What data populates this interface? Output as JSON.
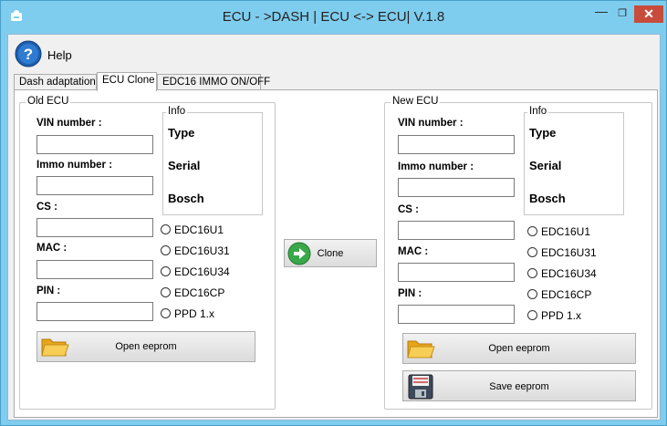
{
  "window": {
    "title": "ECU - >DASH | ECU <-> ECU|           V.1.8",
    "minimize": "—",
    "maximize": "❐",
    "close": "✕"
  },
  "help": {
    "label": "Help"
  },
  "tabs": [
    {
      "label": "Dash adaptation"
    },
    {
      "label": "ECU Clone"
    },
    {
      "label": "EDC16 IMMO ON/OFF"
    }
  ],
  "active_tab": "ECU Clone",
  "old_ecu": {
    "title": "Old ECU",
    "fields": {
      "vin": {
        "label": "VIN number :",
        "value": ""
      },
      "immo": {
        "label": "Immo number :",
        "value": ""
      },
      "cs": {
        "label": "CS :",
        "value": ""
      },
      "mac": {
        "label": "MAC :",
        "value": ""
      },
      "pin": {
        "label": "PIN :",
        "value": ""
      }
    },
    "info": {
      "title": "Info",
      "type": "Type",
      "serial": "Serial",
      "bosch": "Bosch"
    },
    "radios": [
      "EDC16U1",
      "EDC16U31",
      "EDC16U34",
      "EDC16CP",
      "PPD 1.x"
    ],
    "open_button": "Open eeprom"
  },
  "clone_button": "Clone",
  "new_ecu": {
    "title": "New ECU",
    "fields": {
      "vin": {
        "label": "VIN number :",
        "value": ""
      },
      "immo": {
        "label": "Immo number :",
        "value": ""
      },
      "cs": {
        "label": "CS :",
        "value": ""
      },
      "mac": {
        "label": "MAC :",
        "value": ""
      },
      "pin": {
        "label": "PIN :",
        "value": ""
      }
    },
    "info": {
      "title": "Info",
      "type": "Type",
      "serial": "Serial",
      "bosch": "Bosch"
    },
    "radios": [
      "EDC16U1",
      "EDC16U31",
      "EDC16U34",
      "EDC16CP",
      "PPD 1.x"
    ],
    "open_button": "Open eeprom",
    "save_button": "Save eeprom"
  }
}
